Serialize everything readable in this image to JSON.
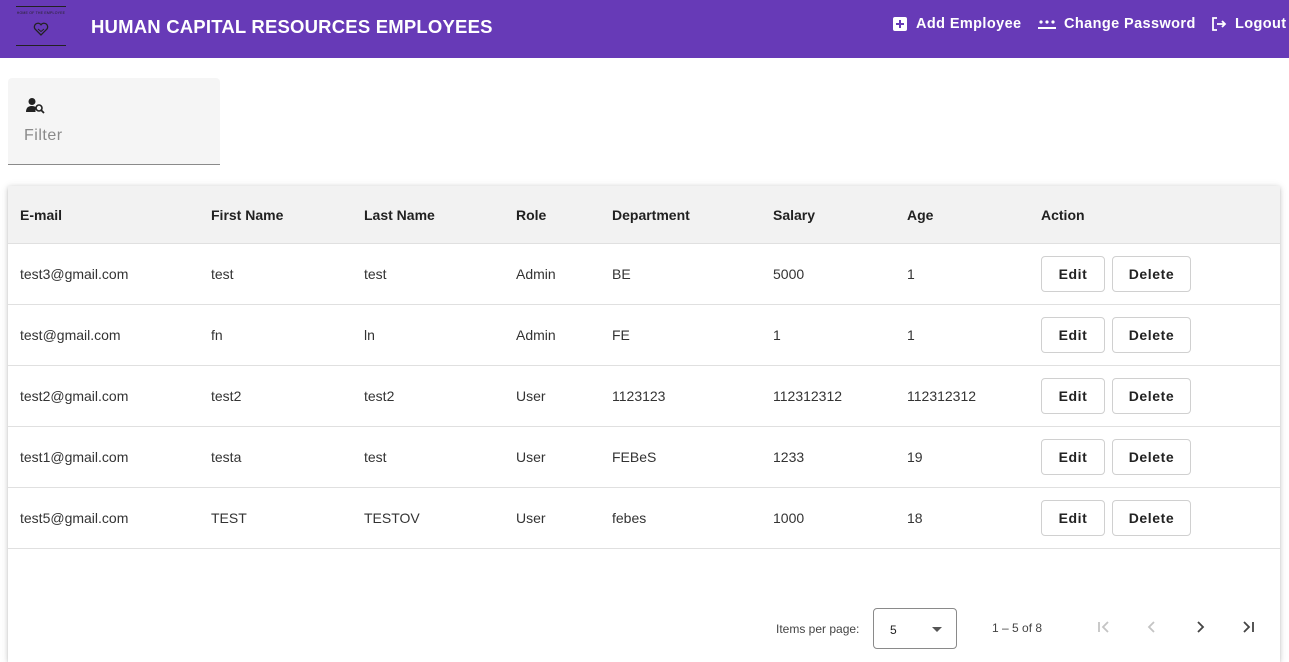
{
  "header": {
    "title": "HUMAN CAPITAL RESOURCES EMPLOYEES",
    "logo_text": "HOME OF THE EMPLOYEE",
    "nav": {
      "add_employee": "Add Employee",
      "change_password": "Change Password",
      "logout": "Logout"
    },
    "bar_color": "#673ab7"
  },
  "filter": {
    "placeholder": "Filter",
    "icon": "person-search-icon"
  },
  "table": {
    "columns": [
      "E-mail",
      "First Name",
      "Last Name",
      "Role",
      "Department",
      "Salary",
      "Age",
      "Action"
    ],
    "rows": [
      {
        "email": "test3@gmail.com",
        "first": "test",
        "last": "test",
        "role": "Admin",
        "dept": "BE",
        "salary": "5000",
        "age": "1"
      },
      {
        "email": "test@gmail.com",
        "first": "fn",
        "last": "ln",
        "role": "Admin",
        "dept": "FE",
        "salary": "1",
        "age": "1"
      },
      {
        "email": "test2@gmail.com",
        "first": "test2",
        "last": "test2",
        "role": "User",
        "dept": "1123123",
        "salary": "112312312",
        "age": "112312312"
      },
      {
        "email": "test1@gmail.com",
        "first": "testa",
        "last": "test",
        "role": "User",
        "dept": "FEBeS",
        "salary": "1233",
        "age": "19"
      },
      {
        "email": "test5@gmail.com",
        "first": "TEST",
        "last": "TESTOV",
        "role": "User",
        "dept": "febes",
        "salary": "1000",
        "age": "18"
      }
    ],
    "edit_label": "Edit",
    "delete_label": "Delete"
  },
  "paginator": {
    "items_per_page_label": "Items per page:",
    "page_size": "5",
    "range_label": "1 – 5 of 8"
  }
}
